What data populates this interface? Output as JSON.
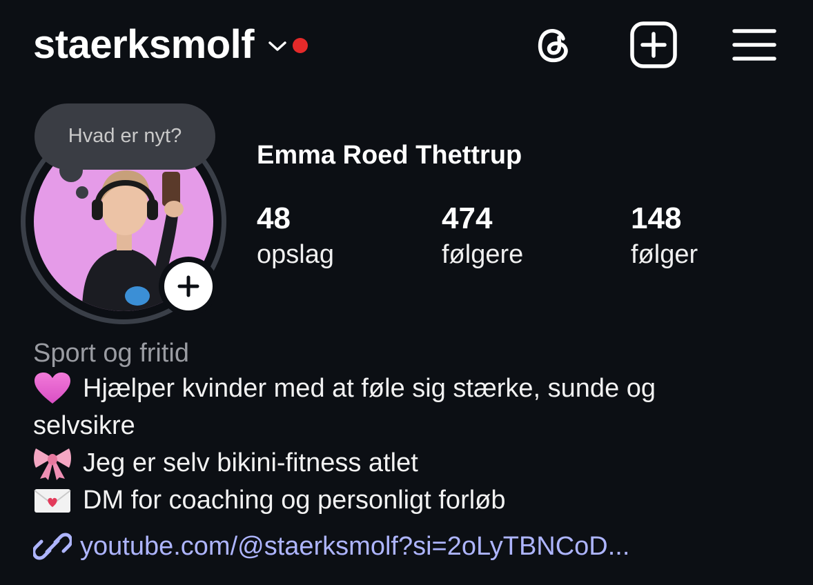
{
  "header": {
    "username": "staerksmolf",
    "notification_color": "#e52a2a",
    "icons": [
      "threads-icon",
      "create-post-icon",
      "menu-icon"
    ]
  },
  "note": {
    "text": "Hvad er nyt?"
  },
  "profile": {
    "full_name": "Emma Roed Thettrup",
    "avatar_background": "#e59be8",
    "stats": [
      {
        "value": "48",
        "label": "opslag"
      },
      {
        "value": "474",
        "label": "følgere"
      },
      {
        "value": "148",
        "label": "følger"
      }
    ]
  },
  "bio": {
    "category": "Sport og fritid",
    "lines": [
      {
        "emoji": "pink-heart-icon",
        "text": "Hjælper kvinder med at føle sig stærke, sunde og"
      },
      {
        "emoji": "",
        "text": "selvsikre"
      },
      {
        "emoji": "pink-bow-icon",
        "text": "Jeg er selv bikini-fitness atlet"
      },
      {
        "emoji": "love-letter-icon",
        "text": "DM for coaching og personligt forløb"
      }
    ],
    "link": "youtube.com/@staerksmolf?si=2oLyTBNCoD...",
    "link_color": "#aeb5ff"
  }
}
